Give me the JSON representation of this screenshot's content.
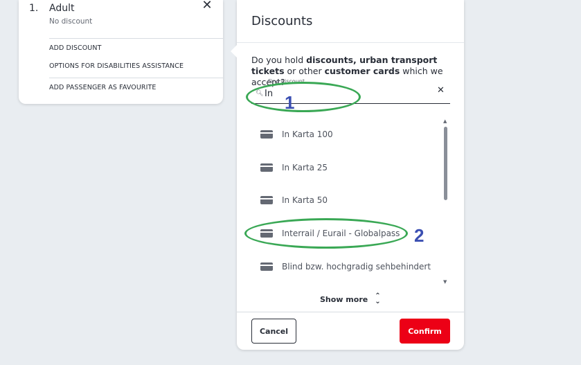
{
  "passenger": {
    "index": "1.",
    "type": "Adult",
    "discount_status": "No discount",
    "actions": [
      "ADD DISCOUNT",
      "OPTIONS FOR DISABILITIES ASSISTANCE",
      "ADD PASSENGER AS FAVOURITE"
    ],
    "close_icon": "close-icon"
  },
  "discounts": {
    "title": "Discounts",
    "intro": {
      "part1": "Do you hold ",
      "bold1": "discounts, urban transport tickets",
      "part2": " or other ",
      "bold2": "customer cards",
      "part3": " which we accept?"
    },
    "search": {
      "label": "Find discount",
      "value": "In",
      "clear_icon": "close-icon"
    },
    "items": [
      {
        "label": "In Karta 100",
        "icon": "card-icon"
      },
      {
        "label": "In Karta 25",
        "icon": "card-icon"
      },
      {
        "label": "In Karta 50",
        "icon": "card-icon"
      },
      {
        "label": "Interrail / Eurail - Globalpass",
        "icon": "card-icon"
      },
      {
        "label": "Blind bzw. hochgradig sehbehindert",
        "icon": "card-icon"
      }
    ],
    "show_more": "Show more",
    "cancel": "Cancel",
    "confirm": "Confirm"
  },
  "annotations": [
    "1",
    "2"
  ],
  "colors": {
    "accent_red": "#ec0016",
    "annotation_green": "#3aa855",
    "annotation_blue": "#3b4fb2"
  }
}
